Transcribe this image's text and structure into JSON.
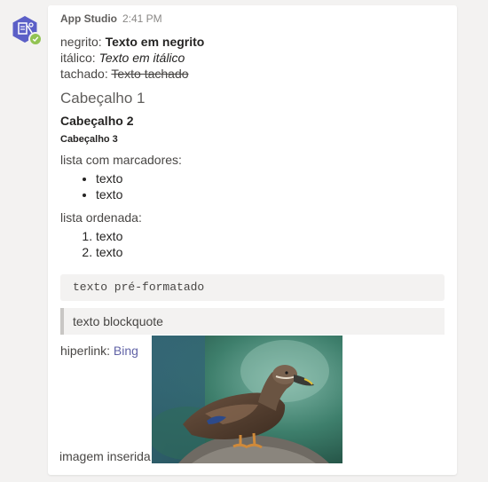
{
  "message": {
    "sender": "App Studio",
    "time": "2:41 PM"
  },
  "content": {
    "bold_label": "negrito:",
    "bold_text": "Texto em negrito",
    "italic_label": "itálico:",
    "italic_text": "Texto em itálico",
    "strike_label": "tachado:",
    "strike_text": "Texto tachado",
    "h1": "Cabeçalho 1",
    "h2": "Cabeçalho 2",
    "h3": "Cabeçalho 3",
    "bullet_label": "lista com marcadores:",
    "bullet_items": [
      "texto",
      "texto"
    ],
    "ordered_label": "lista ordenada:",
    "ordered_items": [
      "texto",
      "texto"
    ],
    "pre_text": "texto pré-formatado",
    "quote_text": "texto blockquote",
    "link_label": "hiperlink:",
    "link_text": "Bing",
    "image_label": "imagem inserida:"
  },
  "colors": {
    "accent": "#6264a7",
    "presence": "#92c353"
  },
  "icons": {
    "avatar": "app-studio-hexagon-icon",
    "presence": "available-check-icon"
  }
}
